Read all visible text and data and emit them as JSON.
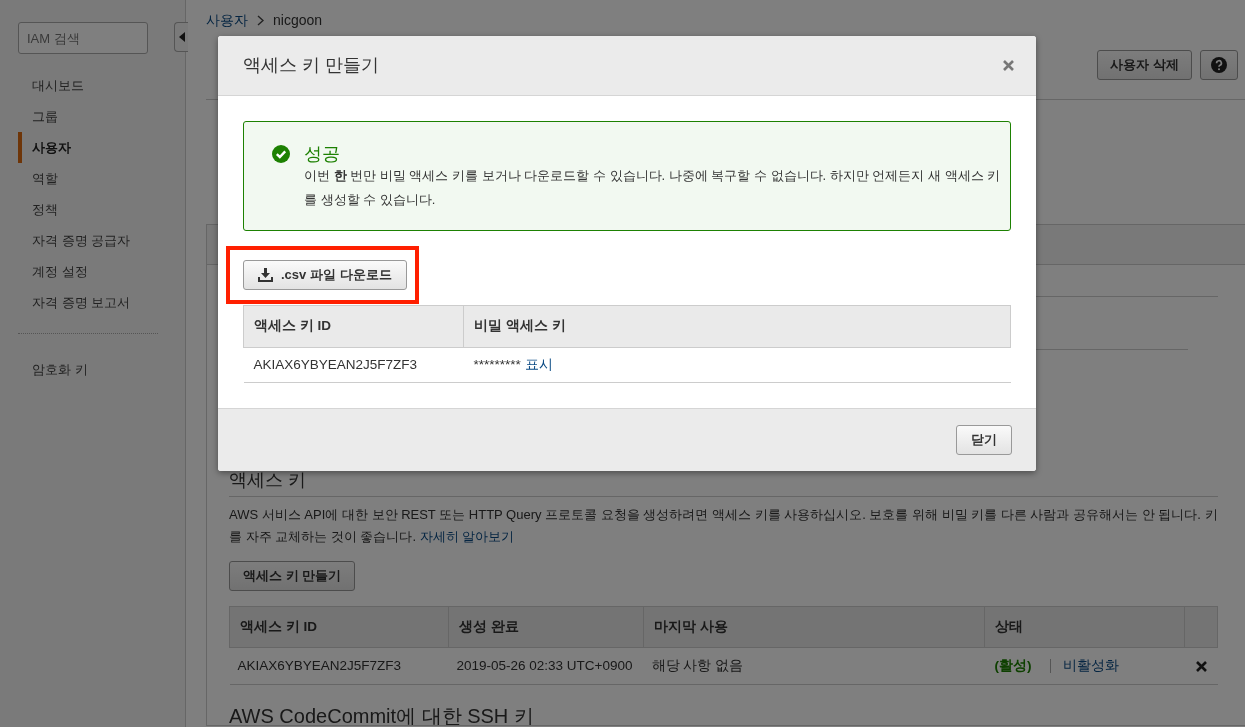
{
  "sidebar": {
    "search_placeholder": "IAM 검색",
    "items": [
      {
        "label": "대시보드",
        "selected": false
      },
      {
        "label": "그룹",
        "selected": false
      },
      {
        "label": "사용자",
        "selected": true
      },
      {
        "label": "역할",
        "selected": false
      },
      {
        "label": "정책",
        "selected": false
      },
      {
        "label": "자격 증명 공급자",
        "selected": false
      },
      {
        "label": "계정 설정",
        "selected": false
      },
      {
        "label": "자격 증명 보고서",
        "selected": false
      }
    ],
    "extra_items": [
      {
        "label": "암호화 키",
        "selected": false
      }
    ]
  },
  "breadcrumb": [
    {
      "label": "사용자",
      "link": true
    },
    {
      "label": "nicgoon",
      "link": false
    }
  ],
  "delete_user_button": "사용자 삭제",
  "access_keys": {
    "title": "액세스 키",
    "description": "AWS 서비스 API에 대한 보안 REST 또는 HTTP Query 프로토콜 요청을 생성하려면 액세스 키를 사용하십시오. 보호를 위해 비밀 키를 다른 사람과 공유해서는 안 됩니다. 키를 자주 교체하는 것이 좋습니다.",
    "learn_more": "자세히 알아보기",
    "create_button": "액세스 키 만들기",
    "columns": [
      "액세스 키 ID",
      "생성 완료",
      "마지막 사용",
      "상태"
    ],
    "rows": [
      {
        "key_id": "AKIAX6YBYEAN2J5F7ZF3",
        "created": "2019-05-26 02:33 UTC+0900",
        "last_used": "해당 사항 없음",
        "status": "(활성)",
        "active": true,
        "action": "비활성화"
      }
    ]
  },
  "next_section_title": "AWS CodeCommit에 대한 SSH 키",
  "modal": {
    "title": "액세스 키 만들기",
    "alert": {
      "title": "성공",
      "message": "이번 **한** 번만 비밀 액세스 키를 보거나 다운로드할 수 있습니다. 나중에 복구할 수 없습니다. 하지만 언제든지 새 액세스 키를 생성할 수 있습니다."
    },
    "download_button": ".csv 파일 다운로드",
    "download_highlighted": true,
    "columns": [
      "액세스 키 ID",
      "비밀 액세스 키"
    ],
    "rows": [
      {
        "key_id": "AKIAX6YBYEAN2J5F7ZF3",
        "secret": "*********",
        "show_link": "표시"
      }
    ],
    "close_button": "닫기"
  }
}
